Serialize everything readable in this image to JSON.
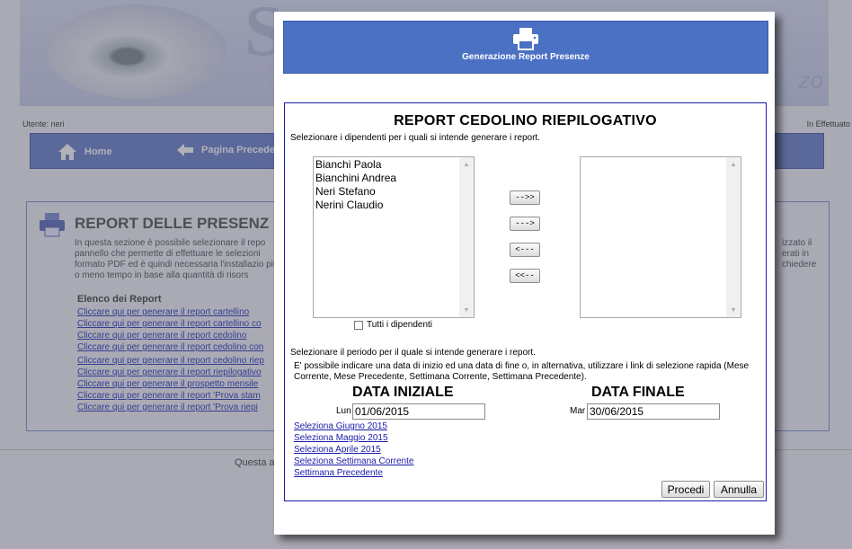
{
  "background": {
    "brand_text": "S",
    "brand_right": "zo",
    "user_label": "Utente: neri",
    "user_right": "In Effettuato",
    "nav": [
      {
        "label": "Home",
        "icon": "home-icon"
      },
      {
        "label": "Pagina Precede",
        "icon": "arrow-left-icon"
      }
    ],
    "section_title": "REPORT DELLE PRESENZ",
    "intro_text": "In questa sezione è possibile selezionare il repo pannello che permette di effettuare le selezioni formato PDF ed è quindi necessaria l'installazio più o meno tempo in base alla quantità di risors",
    "intro_right": "izzato il erati in chiedere",
    "list_title": "Elenco dei Report",
    "links": [
      "Cliccare qui per generare il report cartellino",
      "Cliccare qui per generare il report cartellino co",
      "Cliccare qui per generare il report cedolino",
      "Cliccare qui per generare il report cedolino con",
      "Cliccare qui per generare il report cedolino riep",
      "Cliccare qui per generare il report riepilogativo",
      "Cliccare qui per generare il prospetto mensile",
      "Cliccare qui per generare il report 'Prova stam",
      "Cliccare qui per generare il report 'Prova riepi"
    ],
    "footer_text": "Questa a"
  },
  "modal": {
    "title": "Generazione Report Presenze",
    "icon": "printer-icon",
    "report_title": "REPORT CEDOLINO RIEPILOGATIVO",
    "select_hint": "Selezionare i dipendenti per i quali si intende generare i report.",
    "employees": [
      "Bianchi Paola",
      "Bianchini Andrea",
      "Neri Stefano",
      "Nerini Claudio"
    ],
    "selected_employees": [],
    "buttons": {
      "add_all": "-->>",
      "add": "--->",
      "remove": "<---",
      "remove_all": "<<--"
    },
    "all_employees_label": "Tutti i dipendenti",
    "all_employees_checked": false,
    "period_hint": "Selezionare il periodo per il quale si intende generare i report.",
    "period_desc": "E' possibile indicare una data di inizio ed una data di fine o, in alternativa, utilizzare i link di selezione rapida (Mese Corrente, Mese Precedente, Settimana Corrente, Settimana Precedente).",
    "start": {
      "heading": "DATA INIZIALE",
      "day": "Lun",
      "value": "01/06/2015"
    },
    "end": {
      "heading": "DATA FINALE",
      "day": "Mar",
      "value": "30/06/2015"
    },
    "quick_links": [
      "Seleziona Giugno 2015",
      "Seleziona Maggio 2015",
      "Seleziona Aprile 2015",
      "Seleziona Settimana Corrente",
      "Settimana Precedente"
    ],
    "proceed": "Procedi",
    "cancel": "Annulla"
  },
  "colors": {
    "header_blue": "#4b71c5",
    "border_navy": "#1a1aa0",
    "link_blue": "#1a1aa8"
  }
}
